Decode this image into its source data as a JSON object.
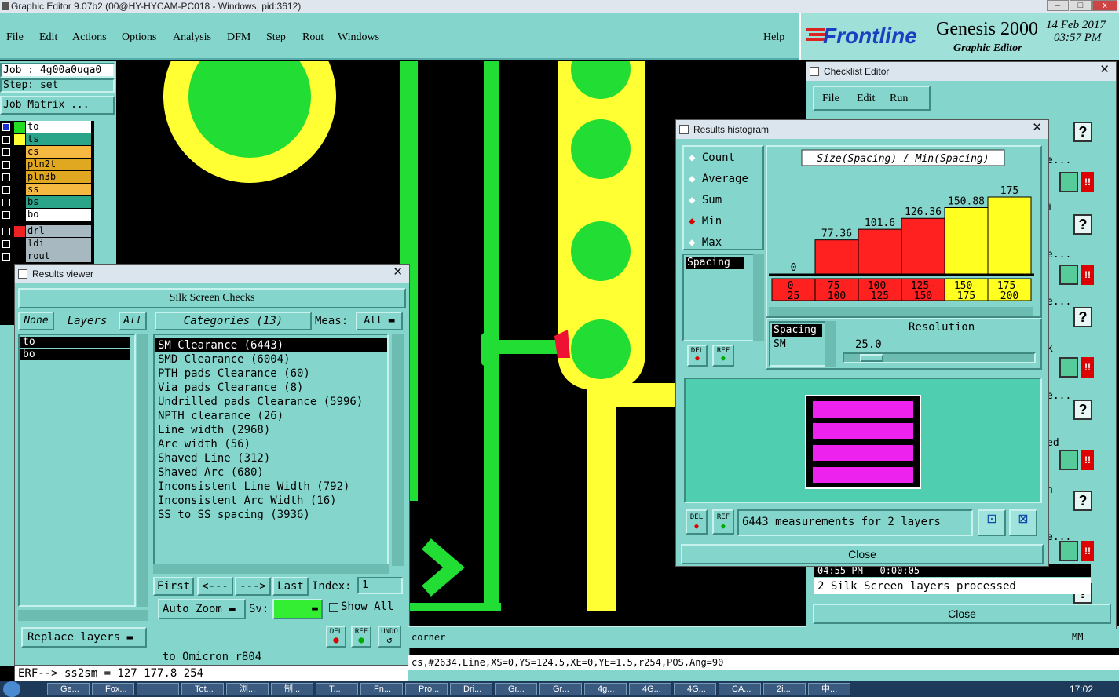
{
  "window": {
    "title": "Graphic Editor 9.07b2 (00@HY-HYCAM-PC018 - Windows, pid:3612)"
  },
  "menu": [
    "File",
    "Edit",
    "Actions",
    "Options",
    "Analysis",
    "DFM",
    "Step",
    "Rout",
    "Windows"
  ],
  "help": "Help",
  "brand": {
    "logo": "Frontline",
    "product": "Genesis 2000",
    "subtitle": "Graphic Editor",
    "date": "14 Feb 2017",
    "time": "03:57 PM"
  },
  "job": {
    "job": "Job : 4g00a0uqa0",
    "step": "Step: set",
    "matrix_btn": "Job Matrix ..."
  },
  "layers": [
    {
      "name": "to",
      "color": "#ffffff",
      "swatch": "#22dd22",
      "active": true
    },
    {
      "name": "ts",
      "color": "#2aa58a",
      "swatch": "#ffff33"
    },
    {
      "name": "cs",
      "color": "#f5b942",
      "swatch": "#000000"
    },
    {
      "name": "pln2t",
      "color": "#e0a820",
      "swatch": "#000000"
    },
    {
      "name": "pln3b",
      "color": "#e0a820",
      "swatch": "#000000"
    },
    {
      "name": "ss",
      "color": "#f5b942",
      "swatch": "#000000"
    },
    {
      "name": "bs",
      "color": "#2aa58a",
      "swatch": "#000000"
    },
    {
      "name": "bo",
      "color": "#ffffff",
      "swatch": "#000000"
    },
    {
      "name": "drl",
      "color": "#a8b8c0",
      "swatch": "#ee2222"
    },
    {
      "name": "ldi",
      "color": "#a8b8c0",
      "swatch": "#000000"
    },
    {
      "name": "rout",
      "color": "#a8b8c0",
      "swatch": "#000000"
    }
  ],
  "results_viewer": {
    "title": "Results viewer",
    "header": "Silk Screen Checks",
    "none": "None",
    "layers_label": "Layers",
    "all": "All",
    "categories_label": "Categories (13)",
    "meas_label": "Meas:",
    "meas_value": "All",
    "layer_list": [
      "to",
      "bo"
    ],
    "categories": [
      "SM Clearance (6443)",
      "SMD Clearance (6004)",
      "PTH pads Clearance (60)",
      "Via pads Clearance (8)",
      "Undrilled pads Clearance (5996)",
      "NPTH clearance (26)",
      "Line width (2968)",
      "Arc width (56)",
      "Shaved Line (312)",
      "Shaved Arc (680)",
      "Inconsistent Line Width (792)",
      "Inconsistent Arc Width (16)",
      "SS to SS spacing (3936)"
    ],
    "first": "First",
    "prev": "<---",
    "next": "--->",
    "last": "Last",
    "index_label": "Index:",
    "index_value": "1",
    "auto_zoom": "Auto Zoom",
    "sv": "Sv:",
    "show_all": "Show All",
    "replace_layers": "Replace layers",
    "del": "DEL",
    "ref": "REF",
    "undo": "UNDO"
  },
  "histogram": {
    "title": "Results histogram",
    "modes": [
      "Count",
      "Average",
      "Sum",
      "Min",
      "Max"
    ],
    "selected_mode": "Min",
    "list_label": "Spacing",
    "del": "DEL",
    "ref": "REF",
    "resolution_label": "Resolution",
    "resolution_value": "25.0",
    "list2": [
      "Spacing",
      "SM"
    ],
    "measurements": "6443 measurements for 2 layers",
    "close": "Close"
  },
  "chart_data": {
    "type": "bar",
    "title": "Size(Spacing) / Min(Spacing)",
    "categories": [
      "0-25",
      "75-100",
      "100-125",
      "125-150",
      "150-175",
      "175-200"
    ],
    "category_labels": [
      [
        "0-",
        "25"
      ],
      [
        "75-",
        "100"
      ],
      [
        "100-",
        "125"
      ],
      [
        "125-",
        "150"
      ],
      [
        "150-",
        "175"
      ],
      [
        "175-",
        "200"
      ]
    ],
    "values": [
      0,
      77.36,
      101.6,
      126.36,
      150.88,
      175
    ],
    "value_labels": [
      "0",
      "77.36",
      "101.6",
      "126.36",
      "150.88",
      "175"
    ],
    "colors": [
      "#ff2020",
      "#ff2020",
      "#ff2020",
      "#ff2020",
      "#ffff20",
      "#ffff20"
    ],
    "ylim": [
      0,
      175
    ]
  },
  "checklist": {
    "title": "Checklist Editor",
    "menu": [
      "File",
      "Edit",
      "Run"
    ],
    "time_row": "04:55 PM - 0:00:05",
    "status": "2 Silk Screen layers processed",
    "close": "Close",
    "side_text": [
      "e...",
      "i",
      "e...",
      "e...",
      "k",
      "e...",
      "ed",
      "n",
      "e..."
    ]
  },
  "canvas": {
    "status_corner": "corner",
    "unit": "MM"
  },
  "bottom": {
    "layer_info": "to Omicron  r804",
    "erf": "ERF--> ss2sm = 127 177.8 254",
    "feature_info": "cs,#2634,Line,XS=0,YS=124.5,XE=0,YE=1.5,r254,POS,Ang=90"
  },
  "taskbar": {
    "items": [
      "Ge...",
      "Fox...",
      "",
      "Tot...",
      "浏...",
      "制...",
      "T...",
      "Fn...",
      "Pro...",
      "Dri...",
      "Gr...",
      "Gr...",
      "4g...",
      "4G...",
      "4G...",
      "CA...",
      "2i...",
      "中..."
    ],
    "clock": "17:02"
  }
}
